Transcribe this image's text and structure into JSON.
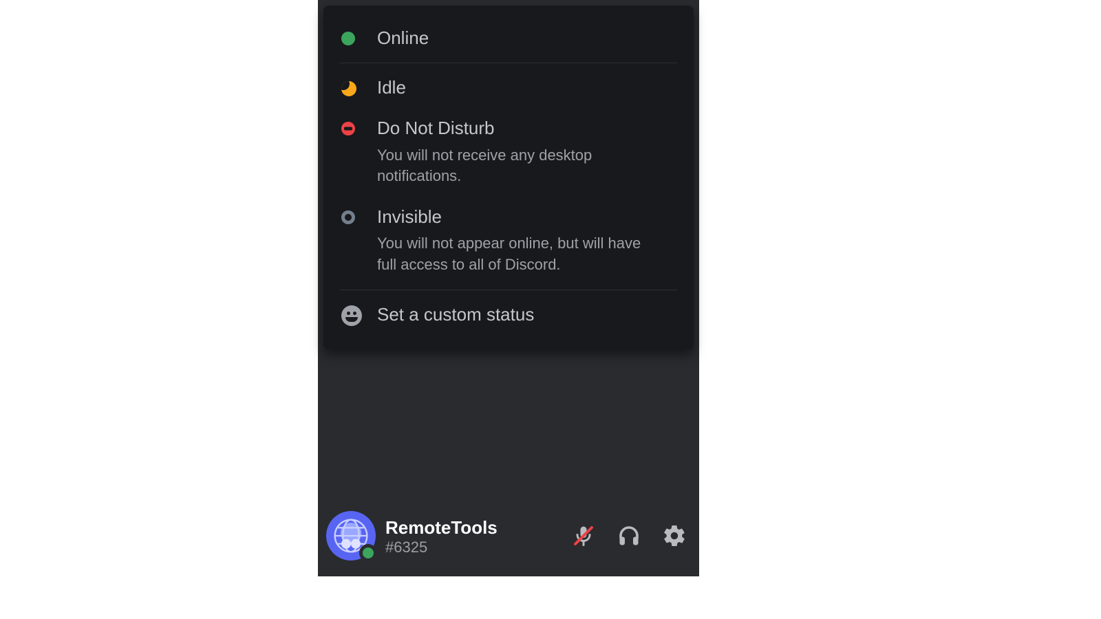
{
  "status_menu": {
    "online": {
      "label": "Online"
    },
    "idle": {
      "label": "Idle"
    },
    "dnd": {
      "label": "Do Not Disturb",
      "description": "You will not receive any desktop notifications."
    },
    "invisible": {
      "label": "Invisible",
      "description": "You will not appear online, but will have full access to all of Discord."
    },
    "custom": {
      "label": "Set a custom status"
    }
  },
  "user": {
    "name": "RemoteTools",
    "discriminator": "#6325",
    "status": "online"
  },
  "colors": {
    "online": "#3ba55d",
    "idle": "#faa81a",
    "dnd": "#ed4245",
    "offline": "#747f8d",
    "icon": "#b9bbbe"
  }
}
